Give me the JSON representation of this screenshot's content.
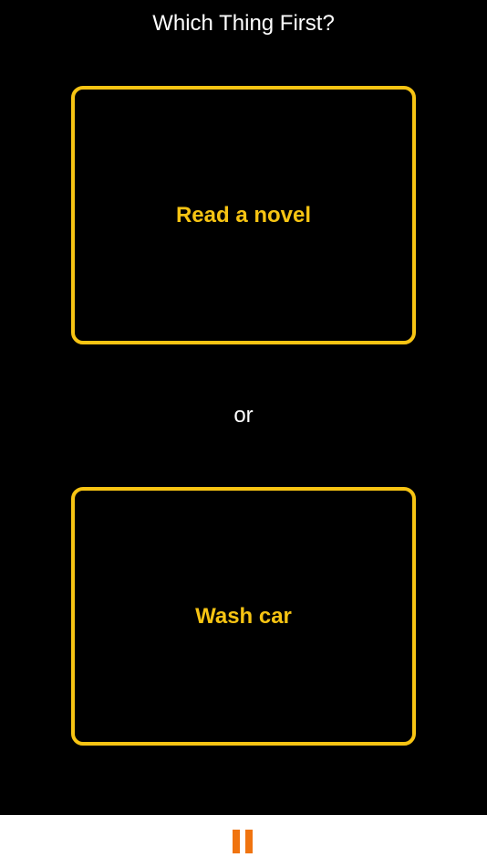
{
  "header": {
    "title": "Which Thing First?"
  },
  "choices": [
    {
      "label": "Read a novel"
    },
    {
      "label": "Wash car"
    }
  ],
  "separator": {
    "text": "or"
  },
  "bottom_bar": {
    "pause_icon": "pause-icon"
  },
  "colors": {
    "background": "#000000",
    "accent": "#f7c413",
    "pause": "#f07410",
    "bottom_bar": "#ffffff"
  }
}
